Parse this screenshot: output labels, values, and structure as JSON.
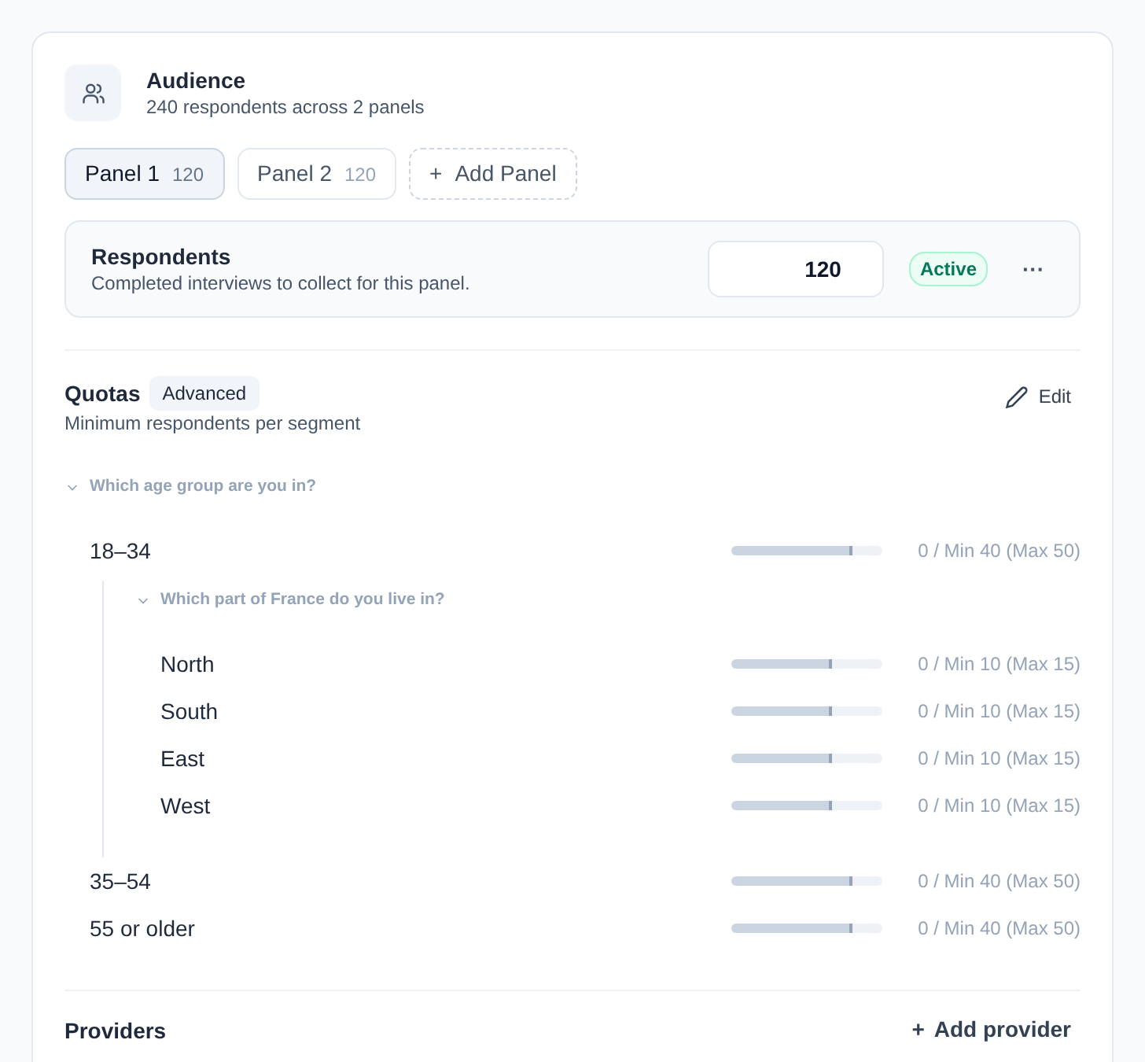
{
  "header": {
    "title": "Audience",
    "subtitle": "240 respondents across 2 panels"
  },
  "panels": [
    {
      "label": "Panel 1",
      "count": "120",
      "selected": true
    },
    {
      "label": "Panel 2",
      "count": "120",
      "selected": false
    }
  ],
  "add_panel": {
    "icon": "+",
    "label": "Add Panel"
  },
  "respondents": {
    "title": "Respondents",
    "description": "Completed interviews to collect for this panel.",
    "value": "120",
    "status": "Active",
    "menu": "···"
  },
  "quotas": {
    "title": "Quotas",
    "badge": "Advanced",
    "subtitle": "Minimum respondents per segment",
    "edit_label": "Edit",
    "tree": [
      {
        "kind": "question",
        "text": "Which age group are you in?",
        "expanded": true,
        "children": [
          {
            "kind": "option",
            "label": "18–34",
            "level": 0.8,
            "reading": "0 / Min 40 (Max 50)",
            "children": [
              {
                "kind": "question",
                "text": "Which part of France do you live in?",
                "expanded": true,
                "children": [
                  {
                    "kind": "option",
                    "label": "North",
                    "level": 0.67,
                    "reading": "0 / Min 10 (Max 15)"
                  },
                  {
                    "kind": "option",
                    "label": "South",
                    "level": 0.67,
                    "reading": "0 / Min 10 (Max 15)"
                  },
                  {
                    "kind": "option",
                    "label": "East",
                    "level": 0.67,
                    "reading": "0 / Min 10 (Max 15)"
                  },
                  {
                    "kind": "option",
                    "label": "West",
                    "level": 0.67,
                    "reading": "0 / Min 10 (Max 15)"
                  }
                ]
              }
            ]
          },
          {
            "kind": "option",
            "label": "35–54",
            "level": 0.8,
            "reading": "0 / Min 40 (Max 50)"
          },
          {
            "kind": "option",
            "label": "55 or older",
            "level": 0.8,
            "reading": "0 / Min 40 (Max 50)"
          }
        ]
      }
    ]
  },
  "providers": {
    "title": "Providers",
    "add_label": "Add provider",
    "add_icon": "+"
  }
}
